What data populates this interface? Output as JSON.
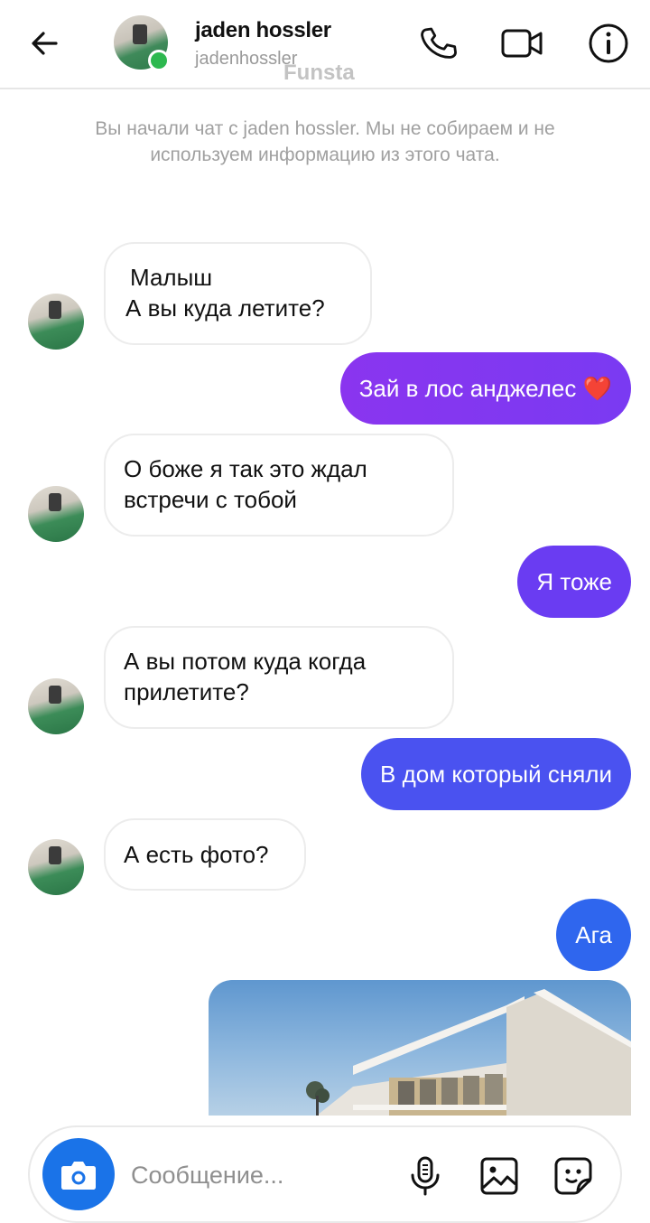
{
  "header": {
    "name": "jaden hossler",
    "username": "jadenhossler",
    "watermark": "Funsta"
  },
  "system_note": "Вы начали чат с jaden hossler. Мы не собираем и не используем информацию из этого чата.",
  "messages": [
    {
      "from": "them",
      "lines": [
        "Малыш",
        "А вы куда летите?"
      ]
    },
    {
      "from": "me",
      "text": "Зай в лос анджелес ❤️",
      "color": "#8a35ef"
    },
    {
      "from": "them",
      "lines": [
        "О боже я так это ждал",
        "встречи с тобой"
      ]
    },
    {
      "from": "me",
      "text": "Я тоже",
      "color": "#6a3cf2"
    },
    {
      "from": "them",
      "lines": [
        "А вы потом куда когда",
        "прилетите?"
      ]
    },
    {
      "from": "me",
      "text": "В дом который сняли",
      "color": "#4a52f0"
    },
    {
      "from": "them",
      "lines": [
        "А есть фото?"
      ]
    },
    {
      "from": "me",
      "text": "Ага",
      "color": "#2f66ee"
    },
    {
      "from": "me",
      "type": "image",
      "description": "house photo"
    }
  ],
  "composer": {
    "placeholder": "Сообщение..."
  },
  "colors": {
    "accent_blue": "#1a73e8",
    "online": "#2db84f"
  },
  "icons": [
    "back-arrow-icon",
    "phone-icon",
    "video-camera-icon",
    "info-icon",
    "camera-icon",
    "microphone-icon",
    "gallery-icon",
    "sticker-icon"
  ]
}
